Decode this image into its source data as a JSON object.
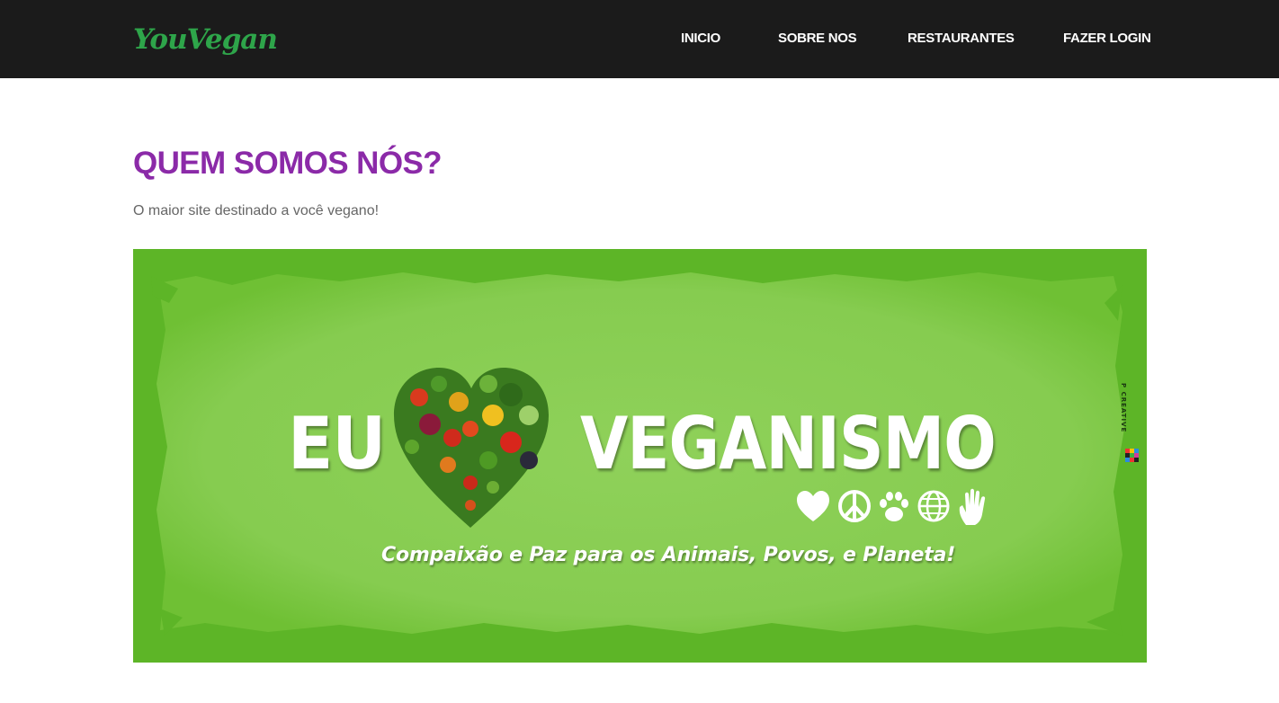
{
  "header": {
    "logo": "YouVegan",
    "nav": [
      {
        "label": "INICIO"
      },
      {
        "label": "SOBRE NOS"
      },
      {
        "label": "RESTAURANTES"
      },
      {
        "label": "FAZER LOGIN"
      }
    ]
  },
  "main": {
    "title": "QUEM SOMOS NÓS?",
    "subtitle": "O maior site destinado a você vegano!"
  },
  "banner": {
    "word_left": "EU",
    "word_right": "VEGANISMO",
    "tagline": "Compaixão e Paz para os Animais, Povos, e Planeta!",
    "credit": "P CREATIVE",
    "icons": [
      "heart-icon",
      "peace-icon",
      "paw-icon",
      "globe-icon",
      "hand-icon"
    ]
  },
  "colors": {
    "navbar": "#1b1b1b",
    "logo": "#2ea54a",
    "title": "#8b2aa8",
    "banner_green": "#63bb2d"
  }
}
